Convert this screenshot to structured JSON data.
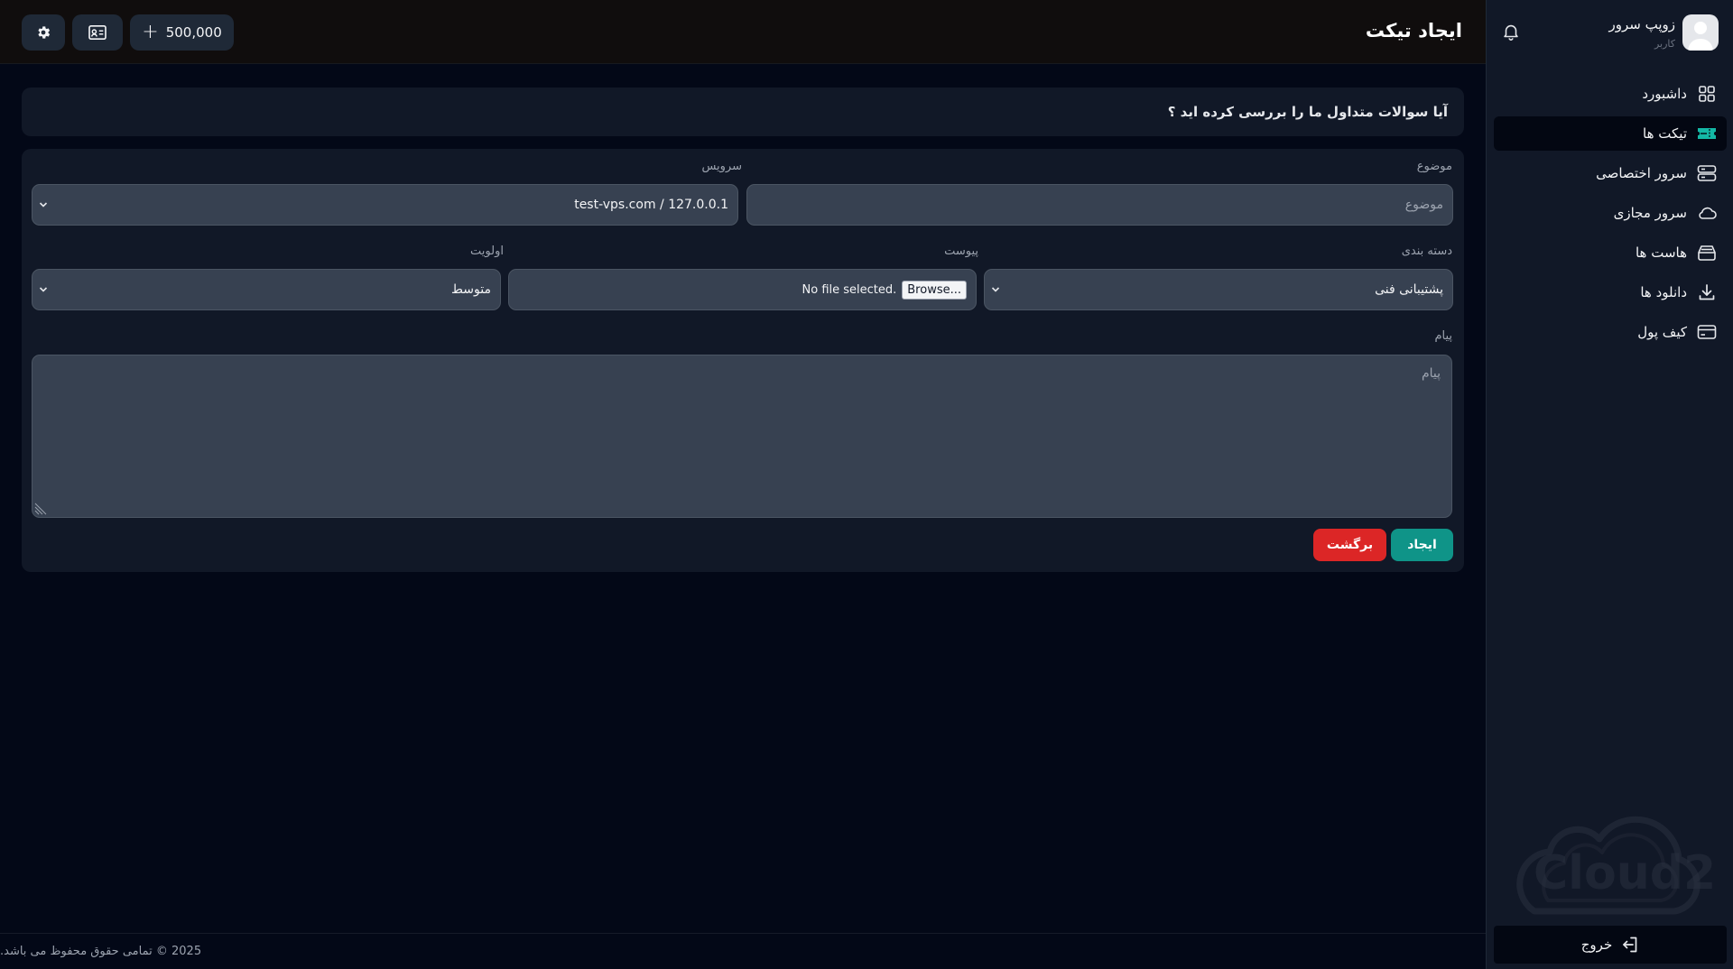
{
  "header": {
    "title": "ایجاد تیکت",
    "balance": "500,000",
    "settings_icon": "gear-icon",
    "card_icon": "id-card-icon",
    "plus_icon": "plus-icon"
  },
  "faq": {
    "text": "آیا سوالات متداول ما را بررسی کرده اید ؟"
  },
  "form": {
    "subject_label": "موضوع",
    "subject_placeholder": "موضوع",
    "service_label": "سرویس",
    "service_value": "test-vps.com / 127.0.0.1",
    "category_label": "دسته بندی",
    "category_value": "پشتیبانی فنی",
    "attachment_label": "پیوست",
    "browse_label": "Browse...",
    "file_status": "No file selected.",
    "priority_label": "اولویت",
    "priority_value": "متوسط",
    "message_label": "پیام",
    "message_placeholder": "پیام",
    "create_label": "ایجاد",
    "back_label": "برگشت"
  },
  "footer": {
    "text": "2025 © تمامی حقوق محفوظ می باشد."
  },
  "sidebar": {
    "user_name": "زوپپ سرور",
    "user_role": "کاربر",
    "items": [
      {
        "label": "داشبورد",
        "icon": "dashboard-icon"
      },
      {
        "label": "تیکت ها",
        "icon": "ticket-icon",
        "active": true
      },
      {
        "label": "سرور اختصاصی",
        "icon": "server-icon"
      },
      {
        "label": "سرور مجازی",
        "icon": "cloud-icon"
      },
      {
        "label": "هاست ها",
        "icon": "host-icon"
      },
      {
        "label": "دانلود ها",
        "icon": "download-icon"
      },
      {
        "label": "کیف پول",
        "icon": "wallet-icon"
      }
    ],
    "brand": "Cloud2",
    "logout_label": "خروج"
  },
  "colors": {
    "accent": "#0f9488",
    "danger": "#dc2626",
    "background": "#030817",
    "card": "#111827",
    "field": "#374151"
  }
}
